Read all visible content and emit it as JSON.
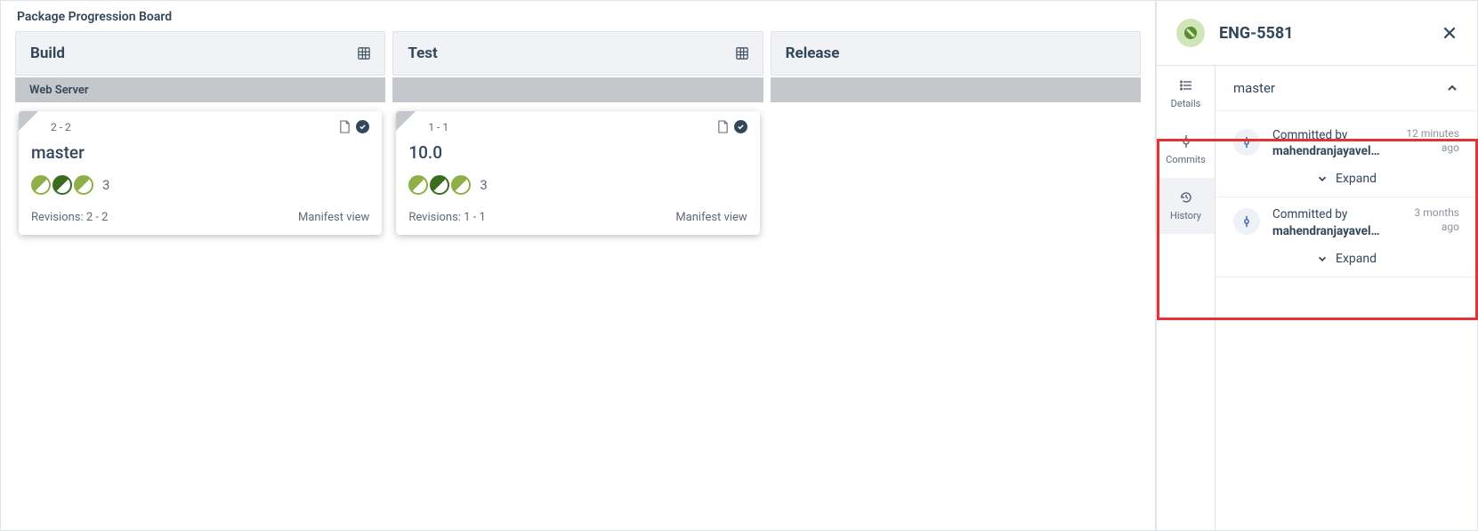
{
  "board": {
    "title": "Package Progression Board",
    "columns": [
      {
        "title": "Build",
        "has_grid_icon": true
      },
      {
        "title": "Test",
        "has_grid_icon": true
      },
      {
        "title": "Release",
        "has_grid_icon": false
      }
    ],
    "swimlane": "Web Server",
    "cards": [
      {
        "range": "2 - 2",
        "title": "master",
        "count": "3",
        "revisions_label": "Revisions: 2 - 2",
        "manifest_label": "Manifest view"
      },
      {
        "range": "1 - 1",
        "title": "10.0",
        "count": "3",
        "revisions_label": "Revisions: 1 - 1",
        "manifest_label": "Manifest view"
      }
    ]
  },
  "side": {
    "title": "ENG-5581",
    "nav": {
      "details": "Details",
      "commits": "Commits",
      "history": "History"
    },
    "branch": "master",
    "expand_label": "Expand",
    "commits": [
      {
        "by_label": "Committed by",
        "author": "mahendranjayavel…",
        "time1": "12 minutes",
        "time2": "ago"
      },
      {
        "by_label": "Committed by",
        "author": "mahendranjayavel…",
        "time1": "3 months",
        "time2": "ago"
      }
    ]
  }
}
